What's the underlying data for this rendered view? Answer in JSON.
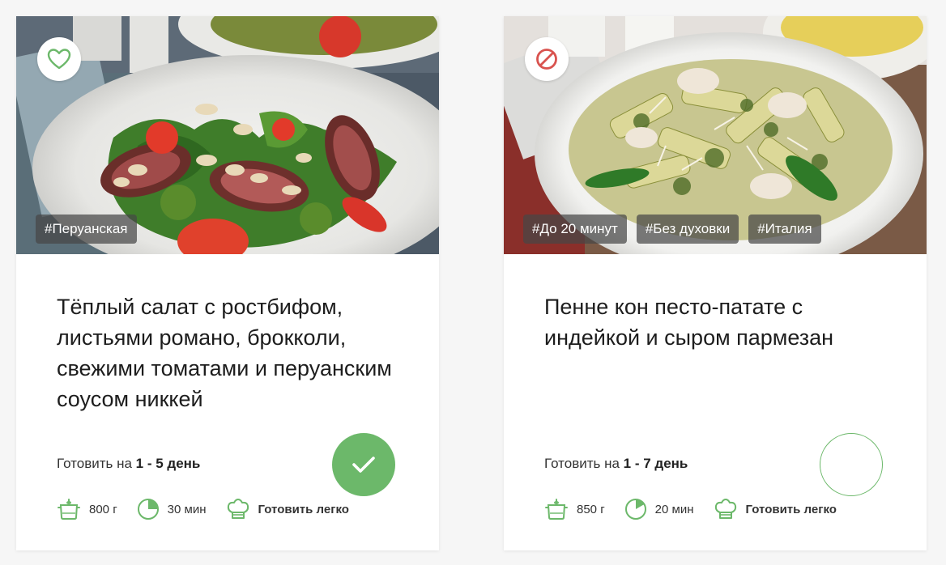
{
  "colors": {
    "accent_green": "#6cb86a",
    "block_red": "#d9534f",
    "tag_bg": "#464646"
  },
  "cards": [
    {
      "corner_icon": "heart-icon",
      "tags": [
        "#Перуанская"
      ],
      "title": "Тёплый салат с ростбифом, листьями романо, брокколи, свежими томатами и перуанским соусом никкей",
      "prep_prefix": "Готовить на",
      "prep_value": "1 - 5 день",
      "selected": true,
      "weight": "800 г",
      "time": "30 мин",
      "difficulty": "Готовить легко"
    },
    {
      "corner_icon": "block-icon",
      "tags": [
        "#До 20 минут",
        "#Без духовки",
        "#Италия"
      ],
      "title": "Пенне кон песто-патате с индейкой и сыром пармезан",
      "prep_prefix": "Готовить на",
      "prep_value": "1 - 7 день",
      "selected": false,
      "weight": "850 г",
      "time": "20 мин",
      "difficulty": "Готовить легко"
    }
  ]
}
